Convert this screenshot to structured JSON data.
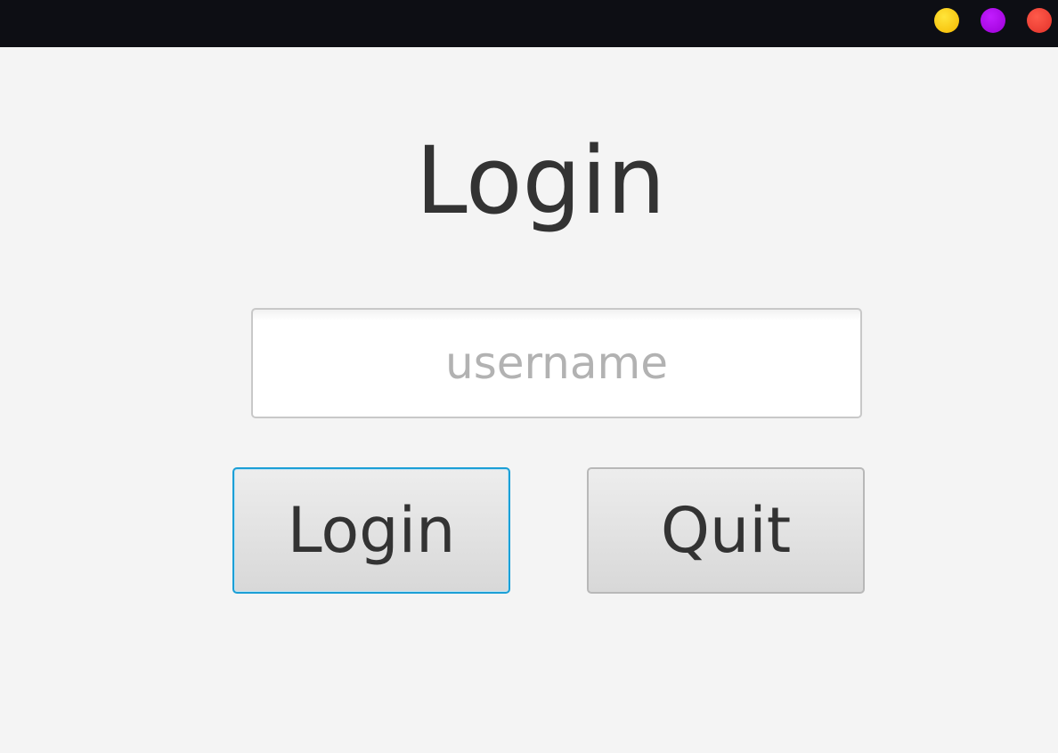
{
  "window": {
    "controls": [
      {
        "name": "minimize",
        "color": "#f9cd0b"
      },
      {
        "name": "maximize",
        "color": "#b10ae8"
      },
      {
        "name": "close",
        "color": "#f2403a"
      }
    ]
  },
  "login_form": {
    "title": "Login",
    "username": {
      "value": "",
      "placeholder": "username"
    },
    "login_button_label": "Login",
    "quit_button_label": "Quit",
    "focus_color": "#1b9fd6"
  }
}
